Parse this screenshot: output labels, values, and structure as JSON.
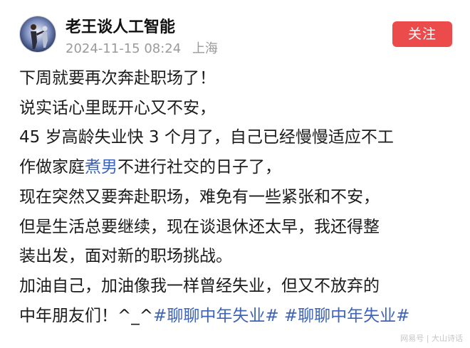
{
  "post": {
    "author": {
      "name": "老王谈人工智能"
    },
    "meta": {
      "date": "2024-11-15 08:24",
      "location": "上海"
    },
    "follow_label": "关注",
    "lines": [
      "下周就要再次奔赴职场了！",
      "说实话心里既开心又不安，",
      "45 岁高龄失业快 3 个月了，自己已经慢慢适应不工"
    ],
    "line4": {
      "before": "作做家庭",
      "link": "煮男",
      "after": "不进行社交的日子了，"
    },
    "lines2": [
      "现在突然又要奔赴职场，难免有一些紧张和不安，",
      "但是生活总要继续，现在谈退休还太早，我还得整",
      "装出发，面对新的职场挑战。",
      "加油自己，加油像我一样曾经失业，但又不放弃的"
    ],
    "last_line": {
      "text": "中年朋友们！^_^",
      "topics": [
        "#聊聊中年失业#",
        "#聊聊中年失业#"
      ]
    }
  },
  "watermark": "网易号 | 大山诗话",
  "colors": {
    "follow_bg": "#ec4b4b",
    "link": "#3d64b8",
    "meta": "#9a9a9a"
  }
}
